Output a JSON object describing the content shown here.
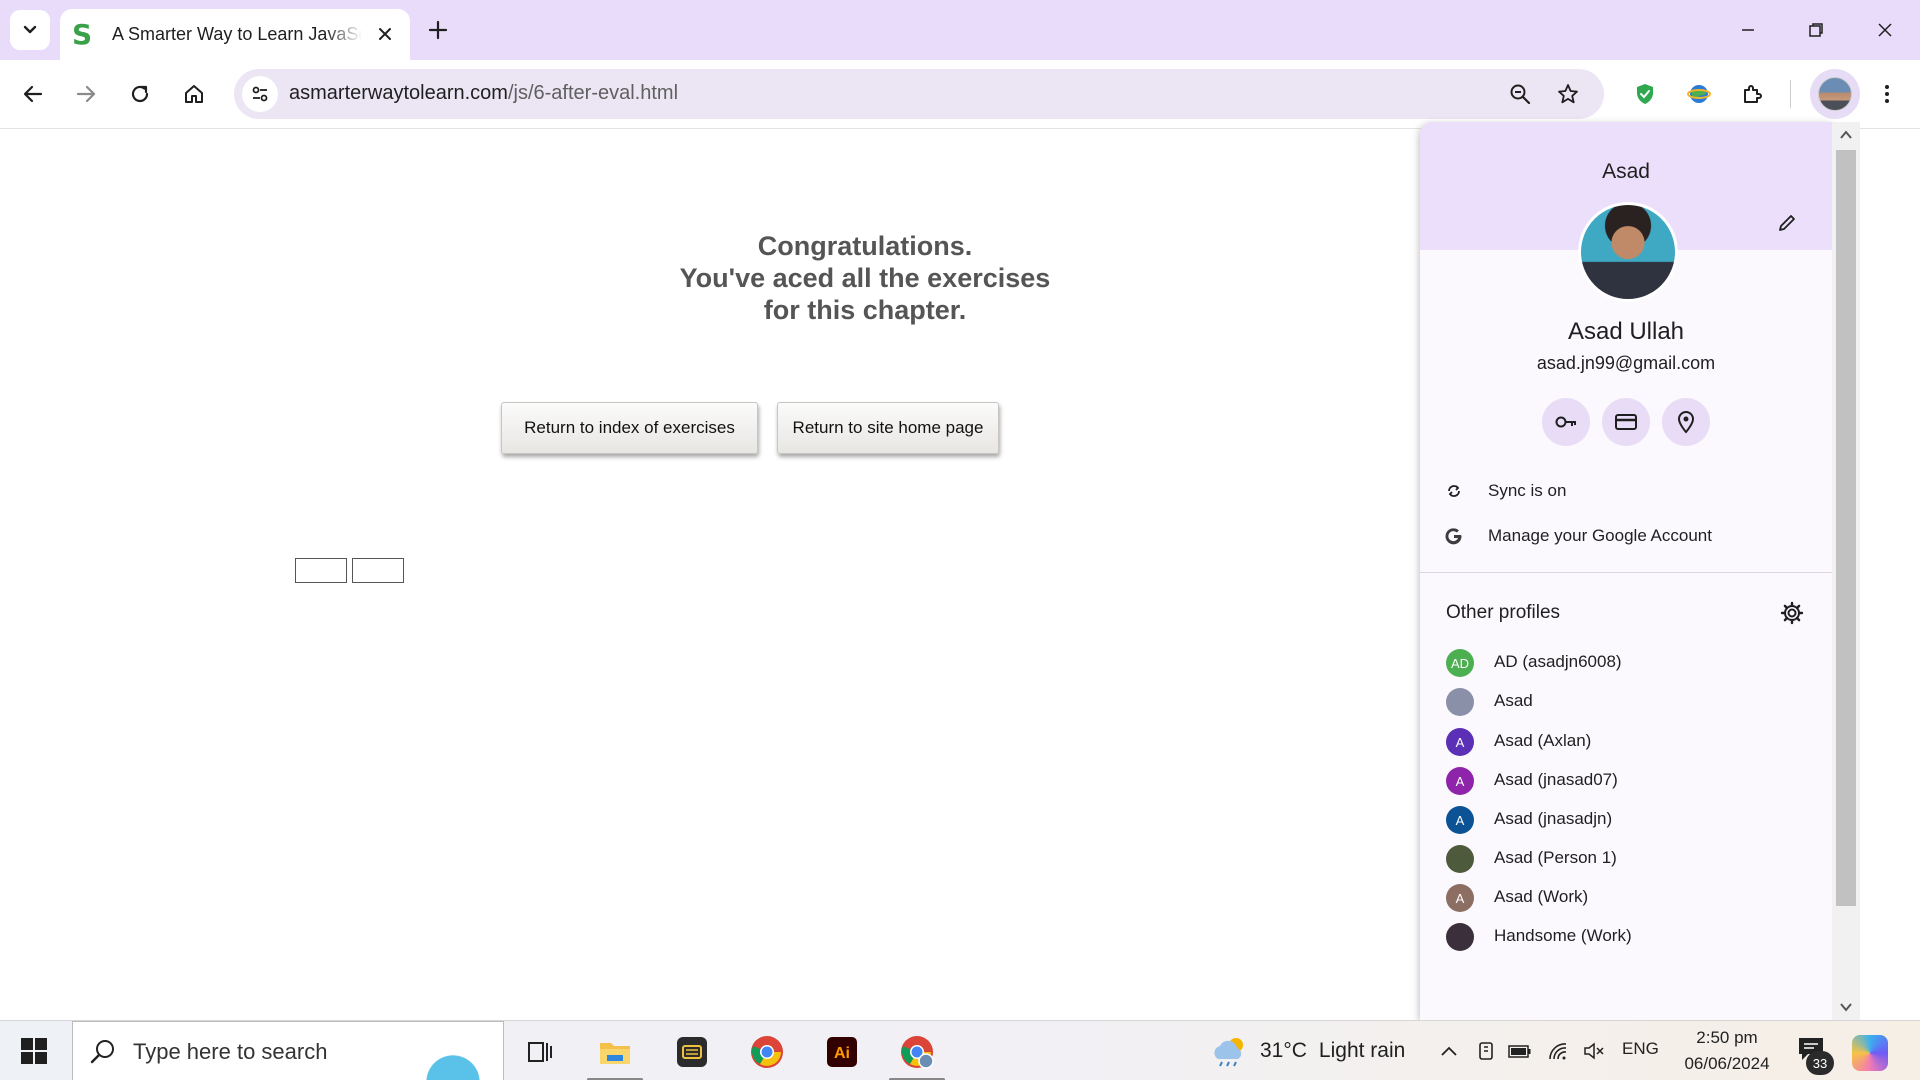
{
  "browser": {
    "tab": {
      "title": "A Smarter Way to Learn JavaScript"
    },
    "omnibox": {
      "url_host": "asmarterwaytolearn.com",
      "url_path": "/js/6-after-eval.html"
    }
  },
  "page": {
    "congrats_line1": "Congratulations.",
    "congrats_line2": "You've aced all the exercises",
    "congrats_line3": "for this chapter.",
    "btn_index": "Return to index of exercises",
    "btn_home": "Return to site home page"
  },
  "profile_panel": {
    "header_name": "Asad",
    "full_name": "Asad Ullah",
    "email": "asad.jn99@gmail.com",
    "sync_label": "Sync is on",
    "manage_label": "Manage your Google Account",
    "other_profiles_title": "Other profiles",
    "profiles": [
      {
        "initials": "AD",
        "name": "AD (asadjn6008)",
        "color": "#4caf50"
      },
      {
        "initials": "",
        "name": "Asad",
        "color": "#8a90a8"
      },
      {
        "initials": "A",
        "name": "Asad (Axlan)",
        "color": "#5b2fb6"
      },
      {
        "initials": "A",
        "name": "Asad (jnasad07)",
        "color": "#8e24aa"
      },
      {
        "initials": "A",
        "name": "Asad (jnasadjn)",
        "color": "#0b5394"
      },
      {
        "initials": "",
        "name": "Asad (Person 1)",
        "color": "#4e5a3c"
      },
      {
        "initials": "A",
        "name": "Asad (Work)",
        "color": "#8d6e63"
      },
      {
        "initials": "",
        "name": "Handsome (Work)",
        "color": "#3a2f3a"
      }
    ]
  },
  "taskbar": {
    "search_placeholder": "Type here to search",
    "weather_temp": "31°C",
    "weather_text": "Light rain",
    "language": "ENG",
    "time": "2:50 pm",
    "date": "06/06/2024",
    "notification_count": "33"
  },
  "colors": {
    "tabstrip": "#e9dcfa",
    "omnibox": "#ece6f4",
    "panel_header": "#ecdffb",
    "congrats_text": "#555555"
  }
}
